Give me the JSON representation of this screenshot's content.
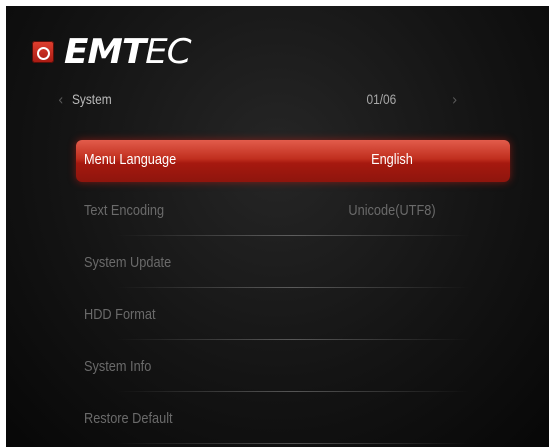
{
  "brand": {
    "name_bold": "EMT",
    "name_light": "EC",
    "icon": "emtec-logo-icon"
  },
  "header": {
    "title": "System",
    "page_counter": "01/06",
    "prev_icon": "chevron-left-icon",
    "next_icon": "chevron-right-icon"
  },
  "menu": {
    "items": [
      {
        "label": "Menu Language",
        "value": "English",
        "selected": true
      },
      {
        "label": "Text Encoding",
        "value": "Unicode(UTF8)"
      },
      {
        "label": "System Update",
        "value": ""
      },
      {
        "label": "HDD Format",
        "value": ""
      },
      {
        "label": "System Info",
        "value": ""
      },
      {
        "label": "Restore Default",
        "value": ""
      }
    ]
  },
  "colors": {
    "highlight": "#c02e1e",
    "background": "#141414",
    "text_dim": "#6a6a6a"
  }
}
